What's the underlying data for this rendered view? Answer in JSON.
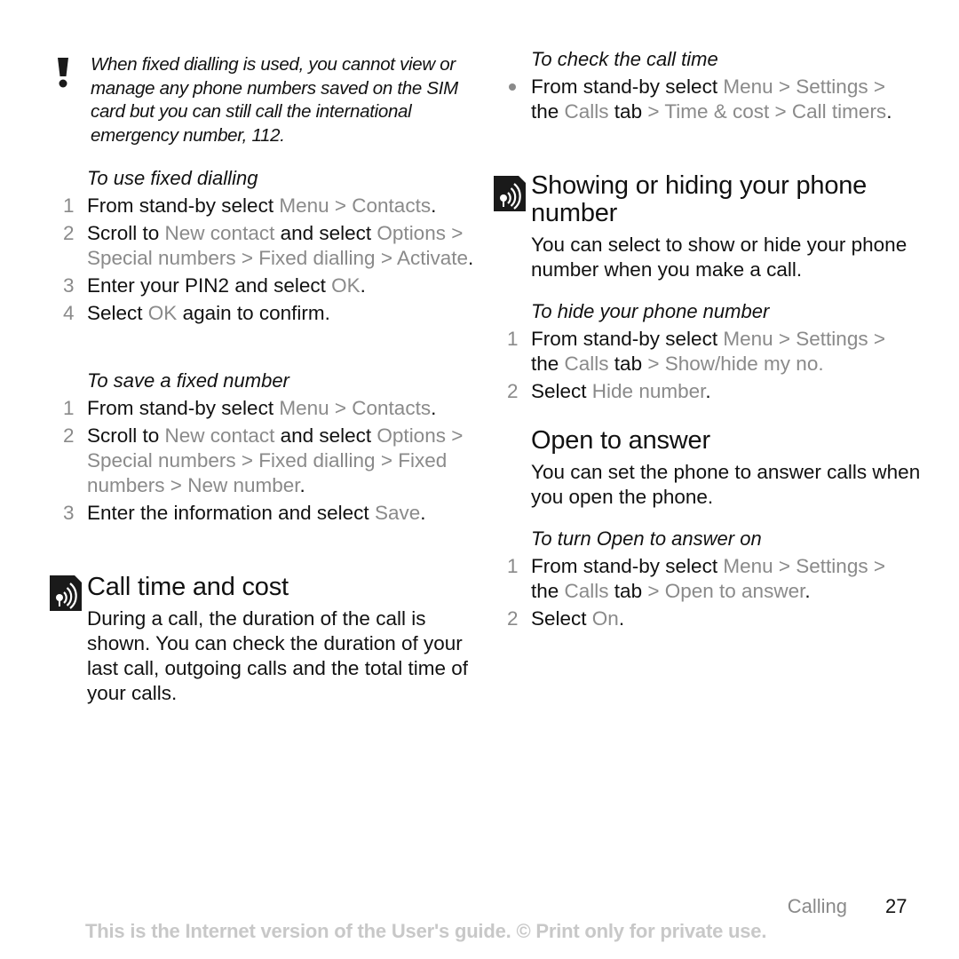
{
  "left": {
    "note": {
      "icon": "exclamation-icon",
      "text": "When fixed dialling is used, you cannot view or manage any phone numbers saved on the SIM card but you can still call the international emergency number, 112."
    },
    "use_fixed": {
      "title": "To use fixed dialling",
      "steps": [
        {
          "num": "1",
          "parts": [
            {
              "t": "From stand-by select "
            },
            {
              "t": "Menu",
              "m": 1
            },
            {
              "t": " > ",
              "m": 1
            },
            {
              "t": "Contacts",
              "m": 1
            },
            {
              "t": "."
            }
          ]
        },
        {
          "num": "2",
          "parts": [
            {
              "t": "Scroll to "
            },
            {
              "t": "New contact",
              "m": 1
            },
            {
              "t": " and select "
            },
            {
              "t": "Options",
              "m": 1
            },
            {
              "t": " > ",
              "m": 1
            },
            {
              "t": "Special numbers",
              "m": 1
            },
            {
              "t": " > ",
              "m": 1
            },
            {
              "t": "Fixed dialling",
              "m": 1
            },
            {
              "t": " > ",
              "m": 1
            },
            {
              "t": "Activate",
              "m": 1
            },
            {
              "t": "."
            }
          ]
        },
        {
          "num": "3",
          "parts": [
            {
              "t": "Enter your PIN2 and select "
            },
            {
              "t": "OK",
              "m": 1
            },
            {
              "t": "."
            }
          ]
        },
        {
          "num": "4",
          "parts": [
            {
              "t": "Select "
            },
            {
              "t": "OK",
              "m": 1
            },
            {
              "t": " again to confirm."
            }
          ]
        }
      ]
    },
    "save_fixed": {
      "title": "To save a fixed number",
      "steps": [
        {
          "num": "1",
          "parts": [
            {
              "t": "From stand-by select "
            },
            {
              "t": "Menu",
              "m": 1
            },
            {
              "t": " > ",
              "m": 1
            },
            {
              "t": "Contacts",
              "m": 1
            },
            {
              "t": "."
            }
          ]
        },
        {
          "num": "2",
          "parts": [
            {
              "t": "Scroll to "
            },
            {
              "t": "New contact",
              "m": 1
            },
            {
              "t": " and select "
            },
            {
              "t": "Options",
              "m": 1
            },
            {
              "t": " > ",
              "m": 1
            },
            {
              "t": "Special numbers",
              "m": 1
            },
            {
              "t": " > ",
              "m": 1
            },
            {
              "t": "Fixed dialling",
              "m": 1
            },
            {
              "t": " > ",
              "m": 1
            },
            {
              "t": "Fixed numbers",
              "m": 1
            },
            {
              "t": " > ",
              "m": 1
            },
            {
              "t": "New number",
              "m": 1
            },
            {
              "t": "."
            }
          ]
        },
        {
          "num": "3",
          "parts": [
            {
              "t": "Enter the information and select "
            },
            {
              "t": "Save",
              "m": 1
            },
            {
              "t": "."
            }
          ]
        }
      ]
    },
    "call_time": {
      "icon": "network-service-icon",
      "heading": "Call time and cost",
      "body": "During a call, the duration of the call is shown. You can check the duration of your last call, outgoing calls and the total time of your calls."
    }
  },
  "right": {
    "check_call_time": {
      "title": "To check the call time",
      "steps": [
        {
          "bullet": true,
          "parts": [
            {
              "t": "From stand-by select "
            },
            {
              "t": "Menu",
              "m": 1
            },
            {
              "t": " > ",
              "m": 1
            },
            {
              "t": "Settings",
              "m": 1
            },
            {
              "t": " > ",
              "m": 1
            },
            {
              "t": "the "
            },
            {
              "t": "Calls",
              "m": 1
            },
            {
              "t": " tab "
            },
            {
              "t": "> ",
              "m": 1
            },
            {
              "t": "Time & cost",
              "m": 1
            },
            {
              "t": " > ",
              "m": 1
            },
            {
              "t": "Call timers",
              "m": 1
            },
            {
              "t": "."
            }
          ]
        }
      ]
    },
    "show_hide": {
      "icon": "network-service-icon",
      "heading": "Showing or hiding your phone number",
      "body": "You can select to show or hide your phone number when you make a call."
    },
    "hide_number": {
      "title": "To hide your phone number",
      "steps": [
        {
          "num": "1",
          "parts": [
            {
              "t": "From stand-by select "
            },
            {
              "t": "Menu",
              "m": 1
            },
            {
              "t": " > ",
              "m": 1
            },
            {
              "t": "Settings",
              "m": 1
            },
            {
              "t": " > ",
              "m": 1
            },
            {
              "t": "the "
            },
            {
              "t": "Calls",
              "m": 1
            },
            {
              "t": " tab "
            },
            {
              "t": "> ",
              "m": 1
            },
            {
              "t": "Show/hide my no.",
              "m": 1
            }
          ]
        },
        {
          "num": "2",
          "parts": [
            {
              "t": "Select "
            },
            {
              "t": "Hide number",
              "m": 1
            },
            {
              "t": "."
            }
          ]
        }
      ]
    },
    "open_to_answer": {
      "heading": "Open to answer",
      "body": "You can set the phone to answer calls when you open the phone."
    },
    "turn_on": {
      "title": "To turn Open to answer on",
      "steps": [
        {
          "num": "1",
          "parts": [
            {
              "t": "From stand-by select "
            },
            {
              "t": "Menu",
              "m": 1
            },
            {
              "t": " > ",
              "m": 1
            },
            {
              "t": "Settings",
              "m": 1
            },
            {
              "t": " > ",
              "m": 1
            },
            {
              "t": "the "
            },
            {
              "t": "Calls",
              "m": 1
            },
            {
              "t": " tab "
            },
            {
              "t": "> ",
              "m": 1
            },
            {
              "t": "Open to answer",
              "m": 1
            },
            {
              "t": "."
            }
          ]
        },
        {
          "num": "2",
          "parts": [
            {
              "t": "Select "
            },
            {
              "t": "On",
              "m": 1
            },
            {
              "t": "."
            }
          ]
        }
      ]
    }
  },
  "footer": {
    "section": "Calling",
    "page_number": "27",
    "notice": "This is the Internet version of the User's guide. © Print only for private use."
  },
  "colors": {
    "text": "#111111",
    "menu_item": "#8a8a8a",
    "footer_notice": "#c8c8c8"
  }
}
